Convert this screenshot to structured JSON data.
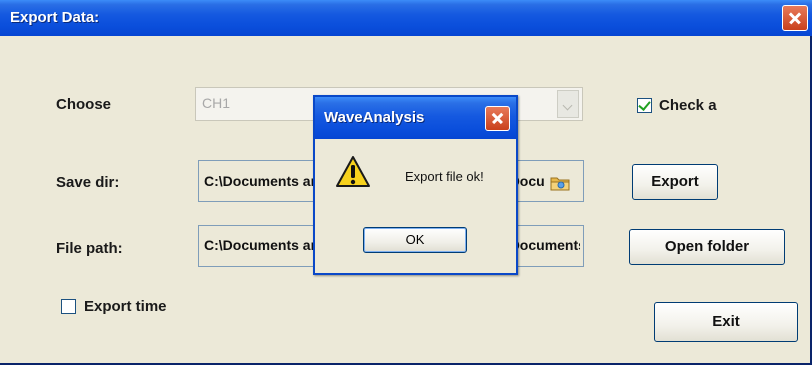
{
  "window": {
    "title": "Export Data:"
  },
  "form": {
    "choose_label": "Choose",
    "channel_value": "CH1",
    "check_label": "Check a",
    "save_dir_label": "Save dir:",
    "save_dir_value": "C:\\Documents and Settings\\Administrator\\My Documents",
    "file_path_label": "File path:",
    "file_path_value": "C:\\Documents and Settings\\Administrator\\My Documents",
    "export_time_label": "Export time",
    "export_button": "Export",
    "open_folder_button": "Open folder",
    "exit_button": "Exit"
  },
  "dialog": {
    "title": "WaveAnalysis",
    "message": "Export file ok!",
    "ok_button": "OK",
    "icon": "warning-icon"
  },
  "colors": {
    "titlebar": "#0b4fdc",
    "window_bg": "#ece9d8",
    "close": "#c9401c"
  }
}
